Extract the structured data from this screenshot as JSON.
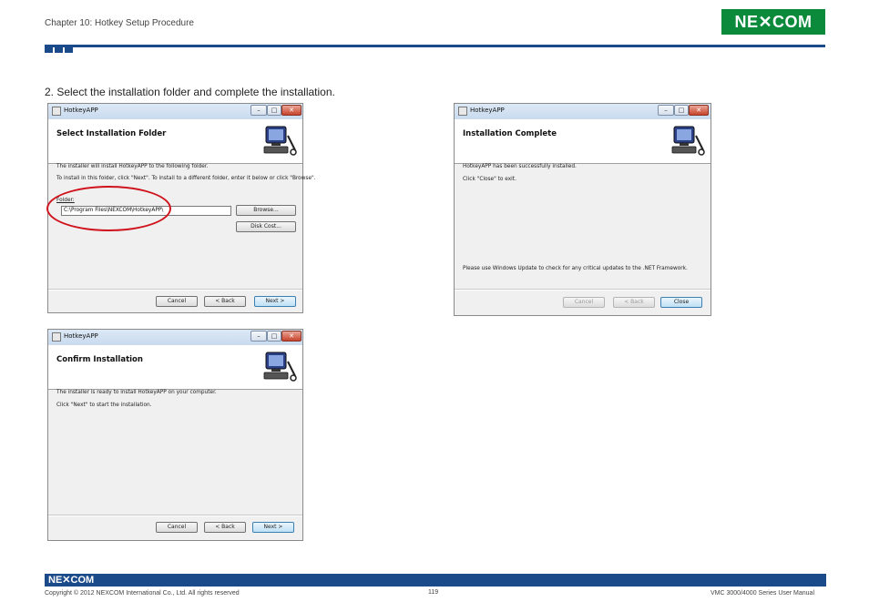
{
  "header": {
    "chapter": "Chapter 10: Hotkey Setup Procedure",
    "logo_text": "NE✕COM",
    "brand_color": "#0a8a3a",
    "accent_color": "#1b4a8a"
  },
  "instruction": "2. Select the installation folder and complete the installation.",
  "dialogs": {
    "select_folder": {
      "window_title": "HotkeyAPP",
      "heading": "Select Installation Folder",
      "line1": "The installer will install HotkeyAPP to the following folder.",
      "line2": "To install in this folder, click \"Next\". To install to a different folder, enter it below or click \"Browse\".",
      "folder_label": "Folder:",
      "folder_value": "C:\\Program Files\\NEXCOM\\HotkeyAPP\\",
      "browse": "Browse...",
      "disk_cost": "Disk Cost...",
      "cancel": "Cancel",
      "back": "< Back",
      "next": "Next >"
    },
    "confirm": {
      "window_title": "HotkeyAPP",
      "heading": "Confirm Installation",
      "line1": "The installer is ready to install HotkeyAPP on your computer.",
      "line2": "Click \"Next\" to start the installation.",
      "cancel": "Cancel",
      "back": "< Back",
      "next": "Next >"
    },
    "complete": {
      "window_title": "HotkeyAPP",
      "heading": "Installation Complete",
      "line1": "HotkeyAPP has been successfully installed.",
      "line2": "Click \"Close\" to exit.",
      "line3": "Please use Windows Update to check for any critical updates to the .NET Framework.",
      "cancel": "Cancel",
      "back": "< Back",
      "close": "Close"
    },
    "window_buttons": {
      "minimize": "–",
      "maximize": "□",
      "close": "✕"
    }
  },
  "footer": {
    "logo_text": "NE✕COM",
    "copyright": "Copyright © 2012 NEXCOM International Co., Ltd. All rights reserved",
    "page_number": "119",
    "manual": "VMC 3000/4000 Series User Manual"
  }
}
